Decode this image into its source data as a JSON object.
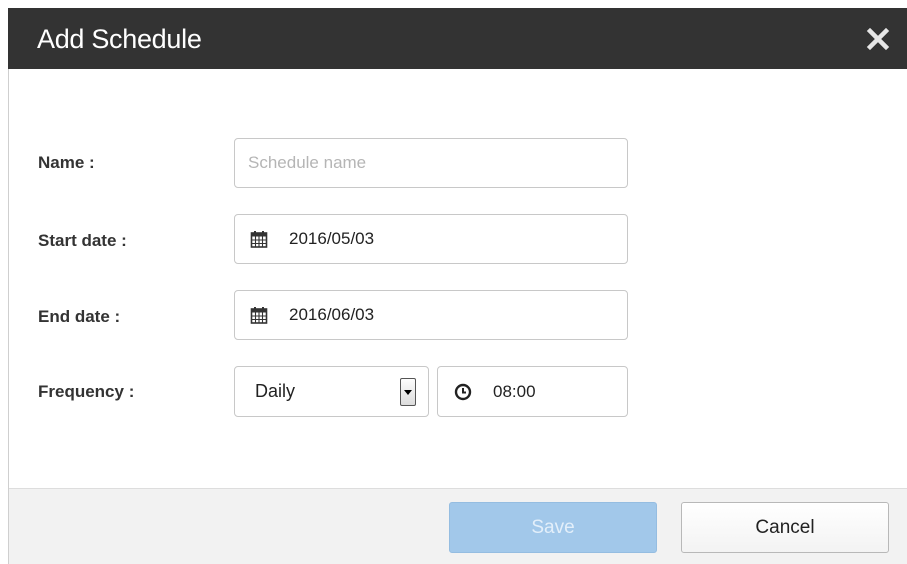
{
  "dialog": {
    "title": "Add Schedule",
    "close_icon": "close-icon"
  },
  "form": {
    "name": {
      "label": "Name :",
      "value": "",
      "placeholder": "Schedule name"
    },
    "start_date": {
      "label": "Start date :",
      "value": "2016/05/03",
      "icon": "calendar-icon"
    },
    "end_date": {
      "label": "End date :",
      "value": "2016/06/03",
      "icon": "calendar-icon"
    },
    "frequency": {
      "label": "Frequency :",
      "selected": "Daily",
      "time": "08:00",
      "time_icon": "clock-icon"
    }
  },
  "footer": {
    "save_label": "Save",
    "cancel_label": "Cancel",
    "save_enabled": false
  },
  "colors": {
    "titlebar": "#333333",
    "save_button": "#a2c8ea",
    "footer_bg": "#f2f2f2"
  }
}
